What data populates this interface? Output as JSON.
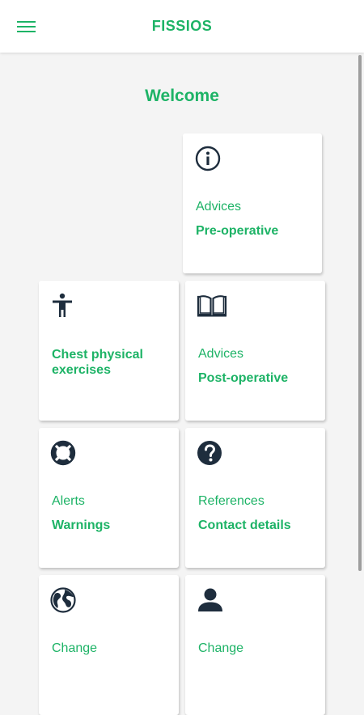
{
  "app": {
    "title": "FISSIOS",
    "menu_icon": "hamburger-menu-icon"
  },
  "welcome": "Welcome",
  "colors": {
    "accent": "#1db366",
    "icon": "#1e2d3d",
    "background": "#f4f4f4"
  },
  "cards": [
    {
      "kicker": "Advices",
      "label": "Pre-operative",
      "icon": "info-circle-icon"
    },
    {
      "kicker": "",
      "label": "Chest physical exercises",
      "icon": "person-standing-icon"
    },
    {
      "kicker": "Advices",
      "label": "Post-operative",
      "icon": "open-book-icon"
    },
    {
      "kicker": "Alerts",
      "label": "Warnings",
      "icon": "life-ring-icon"
    },
    {
      "kicker": "References",
      "label": "Contact details",
      "icon": "question-circle-icon"
    },
    {
      "kicker": "Change",
      "label": "",
      "icon": "globe-icon"
    },
    {
      "kicker": "Change",
      "label": "",
      "icon": "user-icon"
    }
  ]
}
